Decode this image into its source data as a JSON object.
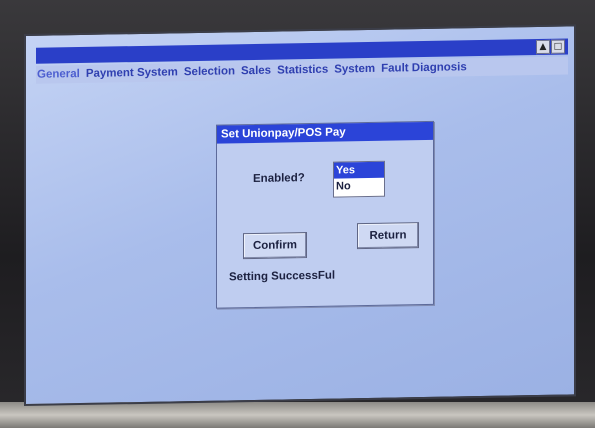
{
  "menu": {
    "items": [
      {
        "label": "General"
      },
      {
        "label": "Payment System"
      },
      {
        "label": "Selection"
      },
      {
        "label": "Sales"
      },
      {
        "label": "Statistics"
      },
      {
        "label": "System"
      },
      {
        "label": "Fault Diagnosis"
      }
    ]
  },
  "titlebar": {
    "buttons": [
      "▲",
      "□"
    ]
  },
  "dialog": {
    "title": "Set Unionpay/POS Pay",
    "enabled_label": "Enabled?",
    "options": [
      "Yes",
      "No"
    ],
    "selected": "Yes",
    "confirm_label": "Confirm",
    "return_label": "Return",
    "status": "Setting SuccessFul"
  },
  "colors": {
    "titlebar": "#2a3fc8",
    "selection": "#2b44d8",
    "screen_bg": "#b3c4ee"
  }
}
